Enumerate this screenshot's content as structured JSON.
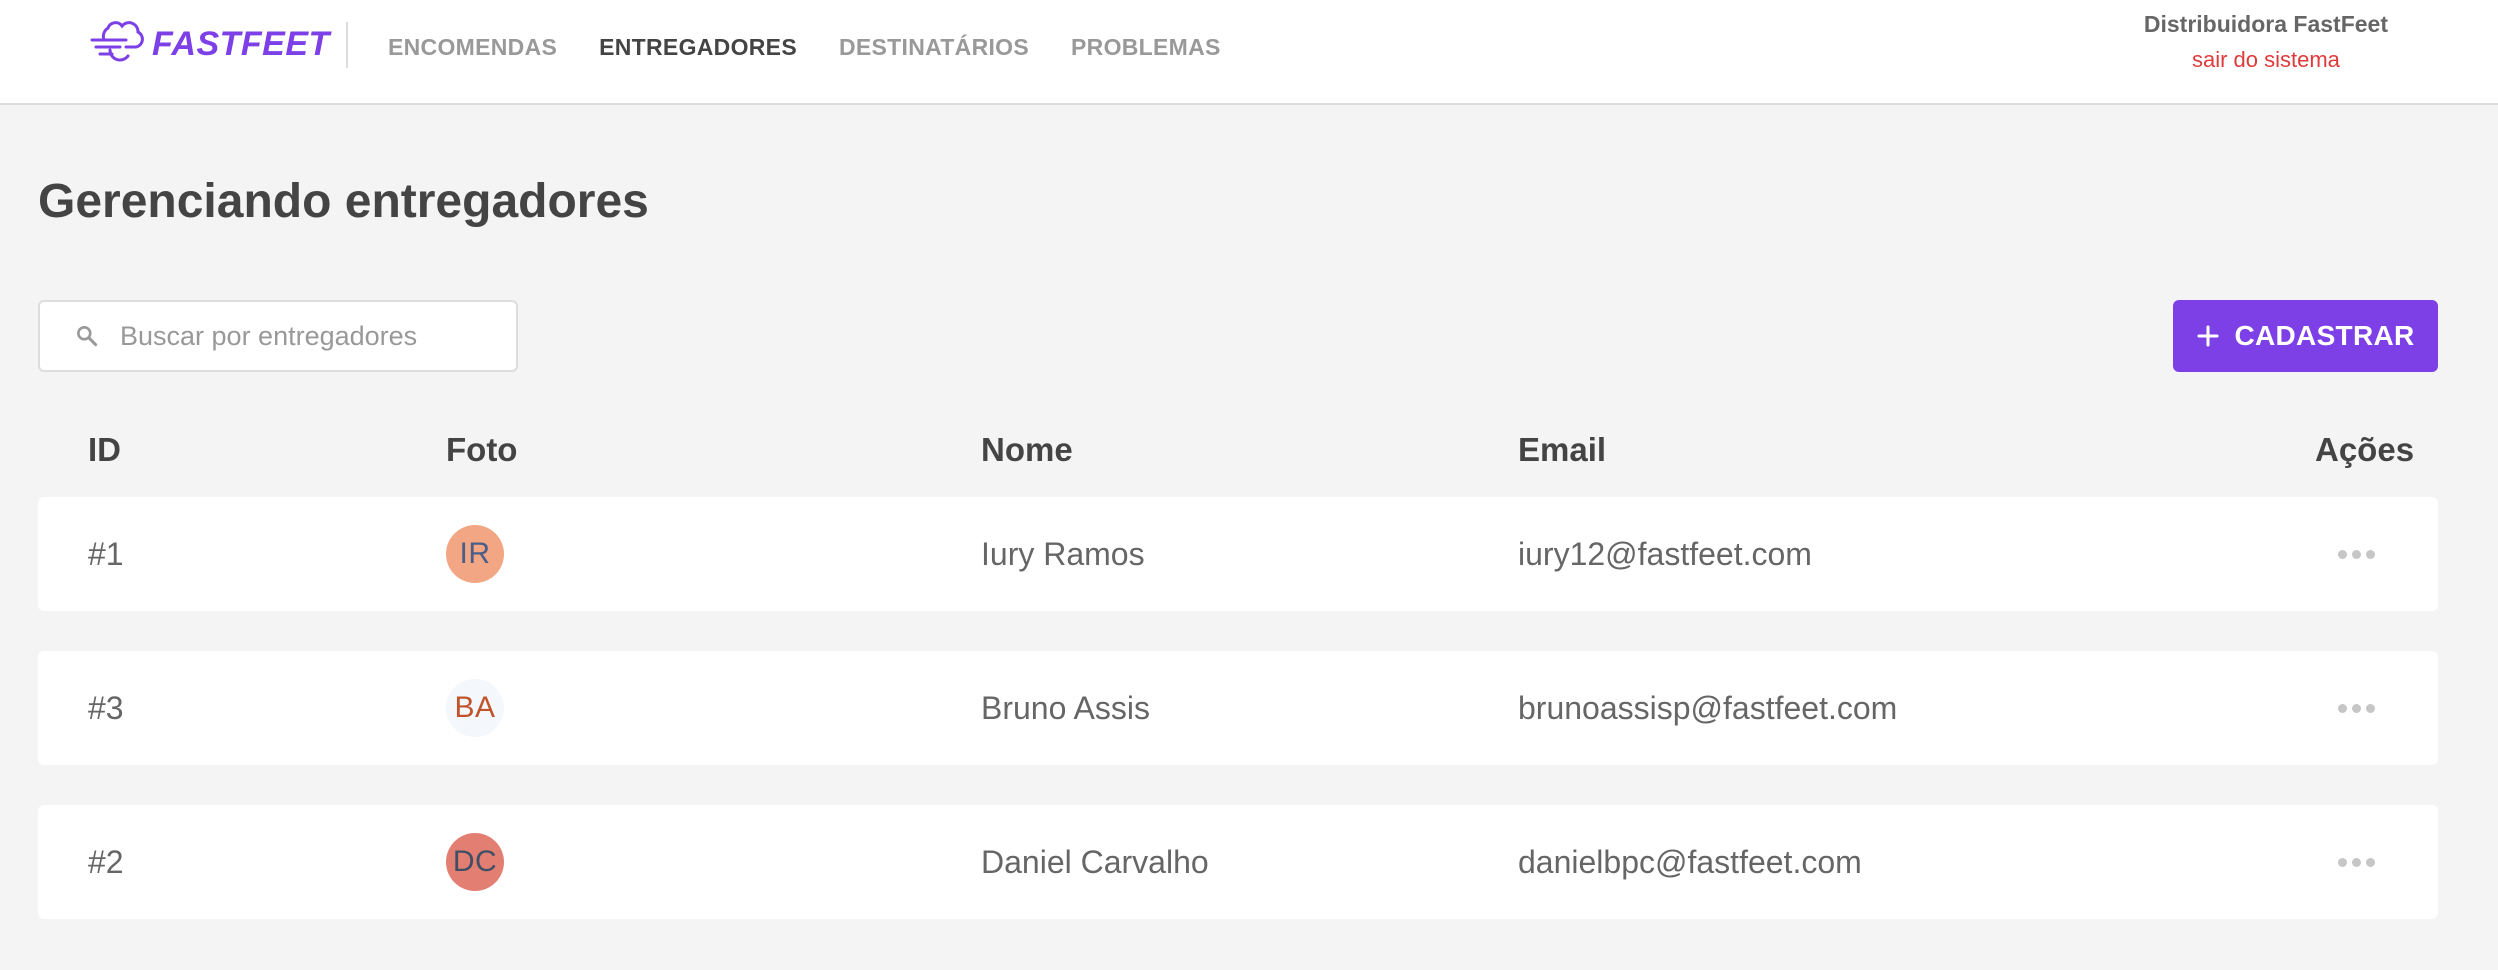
{
  "brand": {
    "name": "FASTFEET",
    "accent_color": "#7d40e7",
    "icon": "fast-delivery-logo-icon"
  },
  "nav": {
    "items": [
      {
        "label": "ENCOMENDAS",
        "active": false
      },
      {
        "label": "ENTREGADORES",
        "active": true
      },
      {
        "label": "DESTINATÁRIOS",
        "active": false
      },
      {
        "label": "PROBLEMAS",
        "active": false
      }
    ]
  },
  "user": {
    "company": "Distribuidora FastFeet",
    "logout_label": "sair do sistema",
    "logout_color": "#de3b3b"
  },
  "page": {
    "title": "Gerenciando entregadores"
  },
  "search": {
    "placeholder": "Buscar por entregadores",
    "value": "",
    "icon": "search-icon"
  },
  "toolbar": {
    "add_label": "CADASTRAR",
    "add_icon": "plus-icon"
  },
  "table": {
    "headers": {
      "id": "ID",
      "photo": "Foto",
      "name": "Nome",
      "email": "Email",
      "actions": "Ações"
    },
    "rows": [
      {
        "id": "#1",
        "initials": "IR",
        "avatar_bg": "#f2a683",
        "avatar_fg": "#4b5e8a",
        "name": "Iury Ramos",
        "email": "iury12@fastfeet.com",
        "actions_icon": "more-horizontal-icon"
      },
      {
        "id": "#3",
        "initials": "BA",
        "avatar_bg": "#f4f8fc",
        "avatar_fg": "#c1532b",
        "name": "Bruno Assis",
        "email": "brunoassisp@fastfeet.com",
        "actions_icon": "more-horizontal-icon"
      },
      {
        "id": "#2",
        "initials": "DC",
        "avatar_bg": "#e37f72",
        "avatar_fg": "#3f4f66",
        "name": "Daniel Carvalho",
        "email": "danielbpc@fastfeet.com",
        "actions_icon": "more-horizontal-icon"
      }
    ]
  }
}
